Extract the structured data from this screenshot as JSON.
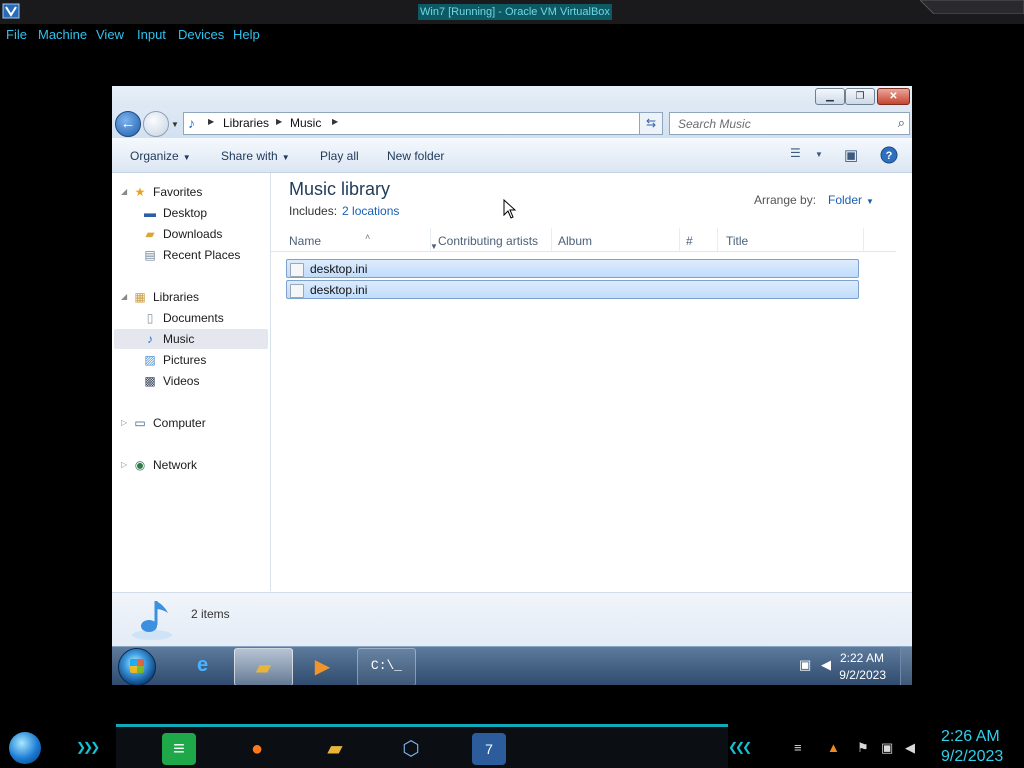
{
  "host": {
    "window_title": "Win7 [Running] - Oracle VM VirtualBox",
    "menu": [
      "File",
      "Machine",
      "View",
      "Input",
      "Devices",
      "Help"
    ],
    "clock": {
      "time": "2:26 AM",
      "date": "9/2/2023"
    },
    "taskbar_apps": [
      "start-orb",
      "notes-app",
      "firefox",
      "file-explorer",
      "virtualbox",
      "win7-vm"
    ]
  },
  "explorer": {
    "caption_buttons": {
      "minimize": "▁",
      "restore": "❐",
      "close": "✕"
    },
    "address": {
      "segments": [
        "Libraries",
        "Music"
      ]
    },
    "search": {
      "placeholder": "Search Music"
    },
    "commands": {
      "organize": "Organize",
      "share_with": "Share with",
      "play_all": "Play all",
      "new_folder": "New folder"
    },
    "nav": {
      "favorites": "Favorites",
      "desktop": "Desktop",
      "downloads": "Downloads",
      "recent_places": "Recent Places",
      "libraries": "Libraries",
      "documents": "Documents",
      "music": "Music",
      "pictures": "Pictures",
      "videos": "Videos",
      "computer": "Computer",
      "network": "Network",
      "selected": "Music"
    },
    "library": {
      "title": "Music library",
      "includes_label": "Includes:",
      "includes_link": "2 locations",
      "arrange_label": "Arrange by:",
      "arrange_value": "Folder"
    },
    "columns": [
      "Name",
      "Contributing artists",
      "Album",
      "#",
      "Title"
    ],
    "files": [
      {
        "name": "desktop.ini"
      },
      {
        "name": "desktop.ini"
      }
    ],
    "details": {
      "count": "2 items"
    }
  },
  "guest_taskbar": {
    "clock": {
      "time": "2:22 AM",
      "date": "9/2/2023"
    },
    "apps": [
      "start-orb",
      "internet-explorer",
      "windows-explorer",
      "media-player",
      "command-prompt"
    ]
  },
  "colors": {
    "vbox_menu_text": "#2fc2ee",
    "w7_taskbar": "#3f5e82",
    "selection": "#cde4fc",
    "link": "#1a5fb4",
    "host_accent": "#0fa9b9"
  }
}
